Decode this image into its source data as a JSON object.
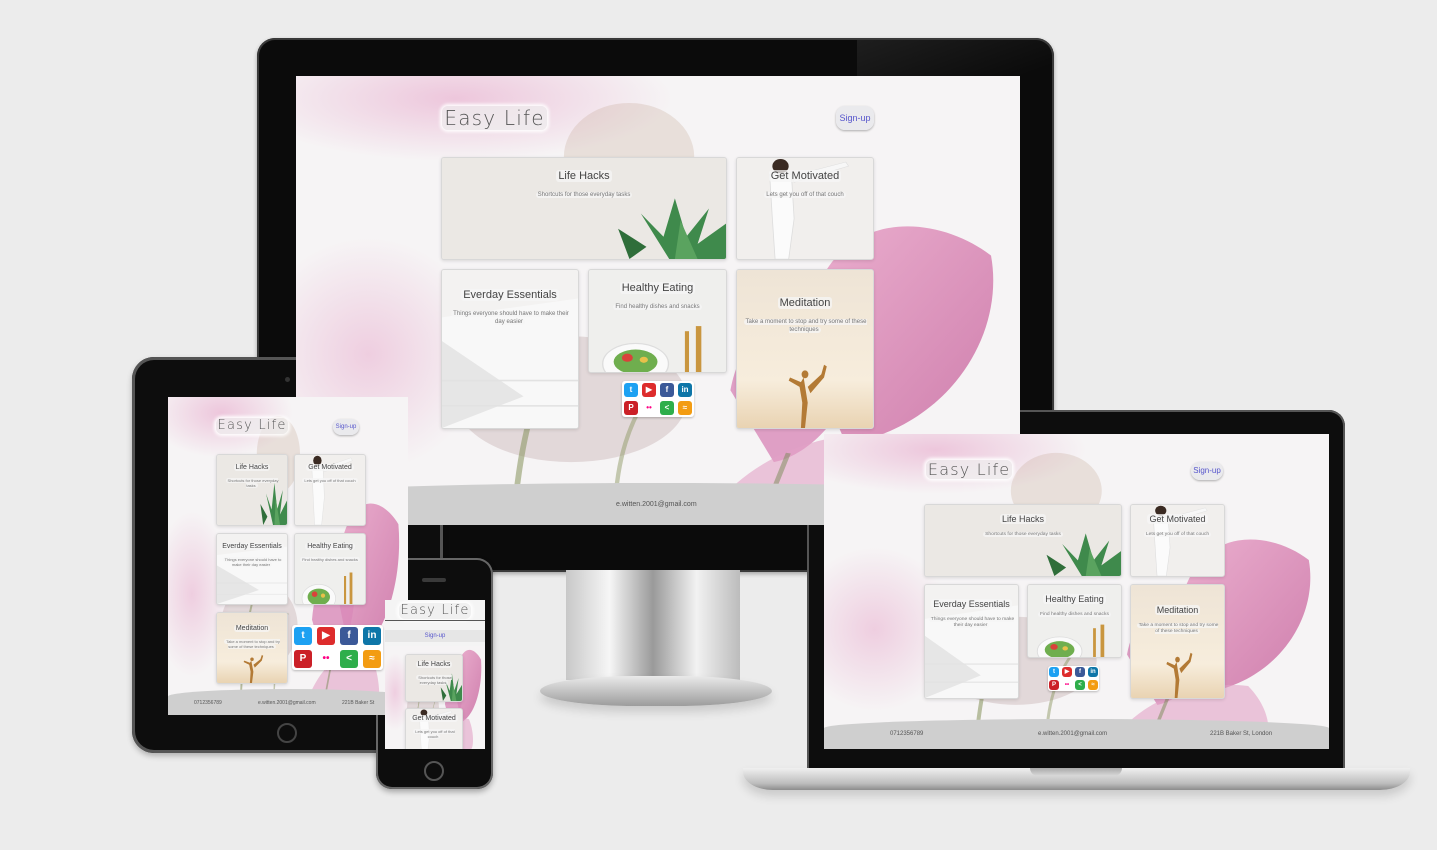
{
  "site": {
    "title": "Easy Life",
    "signup_label": "Sign-up",
    "cards": [
      {
        "title": "Life Hacks",
        "subtitle": "Shortcuts for those everyday tasks"
      },
      {
        "title": "Get Motivated",
        "subtitle": "Lets get you off of that couch"
      },
      {
        "title": "Everday Essentials",
        "subtitle": "Things everyone should have to make their day easier"
      },
      {
        "title": "Healthy Eating",
        "subtitle": "Find healthy dishes and snacks"
      },
      {
        "title": "Meditation",
        "subtitle": "Take a moment to stop and try some of these techniques"
      }
    ],
    "social_icons": [
      "twitter-icon",
      "youtube-icon",
      "facebook-icon",
      "linkedin-icon",
      "pinterest-icon",
      "flickr-icon",
      "share-icon",
      "rss-icon"
    ],
    "footer": {
      "phone": "0712356789",
      "email": "e.witten.2001@gmail.com",
      "address": "221B Baker St, London"
    }
  },
  "tablet_footer_address": "221B Baker St",
  "colors": {
    "background": "#ececec",
    "device_bezel": "#0b0b0b",
    "signup_text": "#5655cc",
    "footer": "#cfcfcf",
    "flower_pink": "#d98ab9",
    "twitter": "#1da1f2",
    "youtube": "#dd2c2c",
    "facebook": "#3b5998",
    "linkedin": "#0e76a8",
    "pinterest": "#cb2027",
    "share": "#2eae4b",
    "rss": "#f39c12"
  }
}
